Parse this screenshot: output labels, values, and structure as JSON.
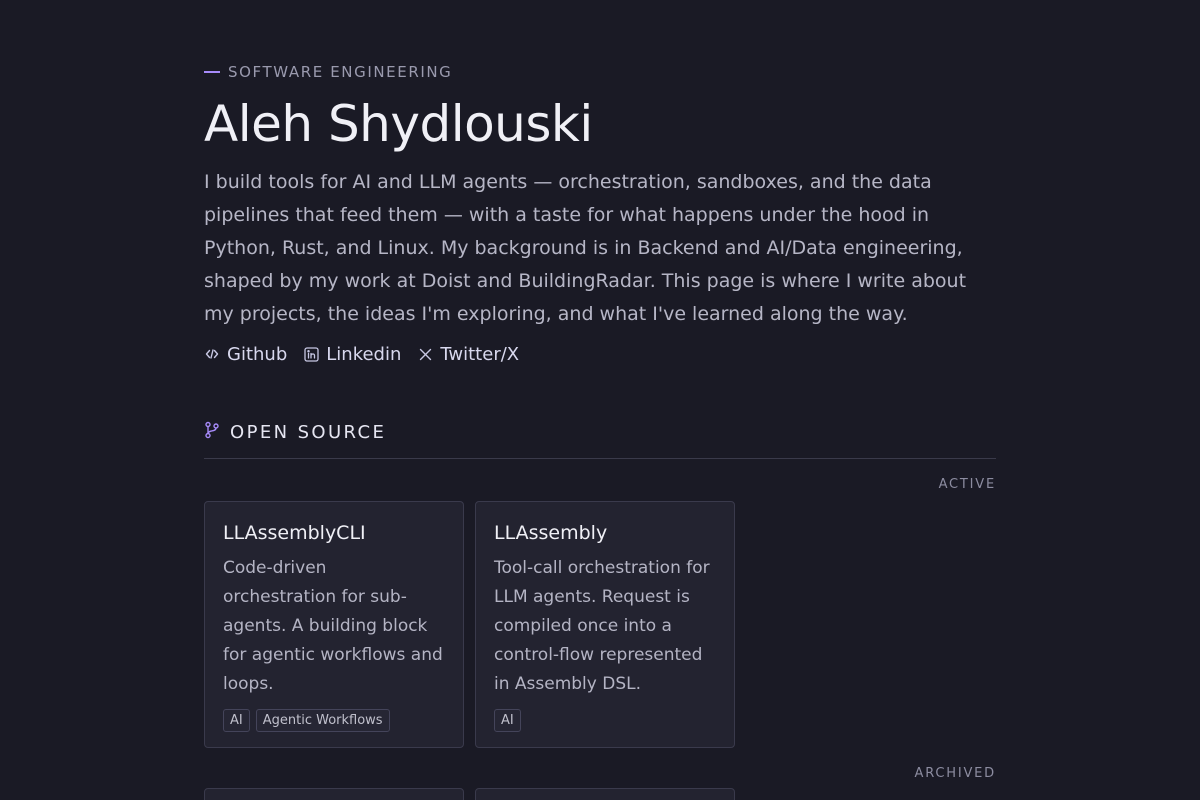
{
  "header": {
    "eyebrow": "SOFTWARE ENGINEERING",
    "name": "Aleh Shydlouski",
    "bio": "I build tools for AI and LLM agents — orchestration, sandboxes, and the data pipelines that feed them — with a taste for what happens under the hood in Python, Rust, and Linux. My background is in Backend and AI/Data engineering, shaped by my work at Doist and BuildingRadar. This page is where I write about my projects, the ideas I'm exploring, and what I've learned along the way."
  },
  "links": [
    {
      "label": "Github",
      "icon": "code-icon"
    },
    {
      "label": "Linkedin",
      "icon": "linkedin-icon"
    },
    {
      "label": "Twitter/X",
      "icon": "x-icon"
    }
  ],
  "section": {
    "title": "OPEN SOURCE",
    "icon": "git-branch-icon"
  },
  "groups": {
    "active": "ACTIVE",
    "archived": "ARCHIVED"
  },
  "projects": [
    {
      "title": "LLAssemblyCLI",
      "description": "Code-driven orchestration for sub-agents. A building block for agentic workflows and loops.",
      "tags": [
        "AI",
        "Agentic Workflows"
      ]
    },
    {
      "title": "LLAssembly",
      "description": "Tool-call orchestration for LLM agents. Request is compiled once into a control-flow represented in Assembly DSL.",
      "tags": [
        "AI"
      ]
    }
  ],
  "colors": {
    "background": "#1a1a25",
    "accent": "#a78bfa",
    "card": "#232330"
  }
}
